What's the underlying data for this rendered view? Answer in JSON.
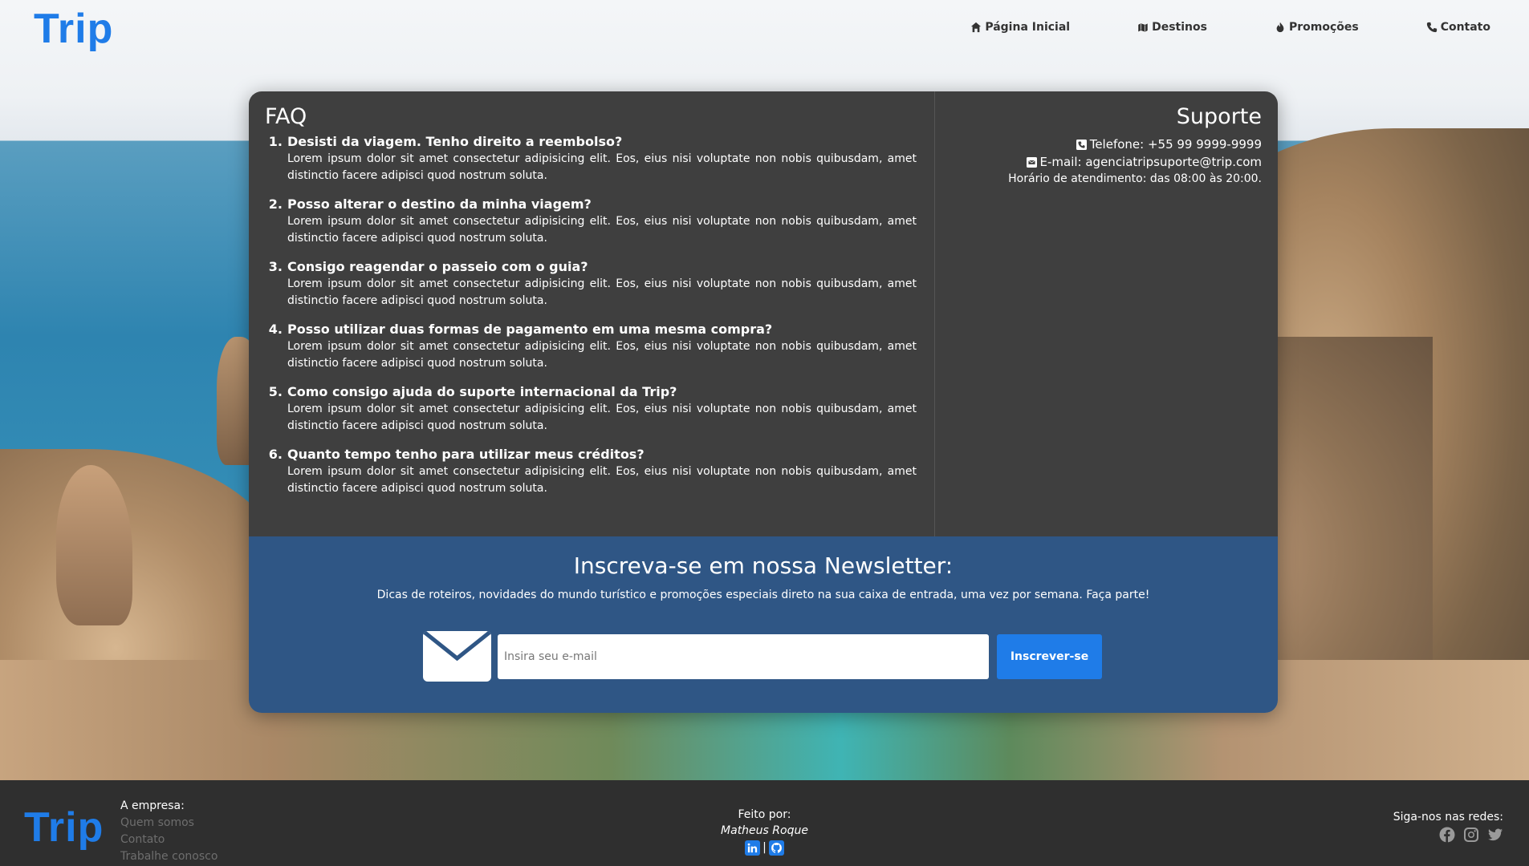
{
  "brand": {
    "logo": "Trip"
  },
  "nav": {
    "items": [
      {
        "label": "Página Inicial",
        "icon": "home-icon"
      },
      {
        "label": "Destinos",
        "icon": "map-icon"
      },
      {
        "label": "Promoções",
        "icon": "fire-icon"
      },
      {
        "label": "Contato",
        "icon": "phone-icon"
      }
    ]
  },
  "faq": {
    "title": "FAQ",
    "items": [
      {
        "num": "1.",
        "question": "Desisti da viagem. Tenho direito a reembolso?",
        "answer": "Lorem ipsum dolor sit amet consectetur adipisicing elit. Eos, eius nisi voluptate non nobis quibusdam, amet distinctio facere adipisci quod nostrum soluta."
      },
      {
        "num": "2.",
        "question": "Posso alterar o destino da minha viagem?",
        "answer": "Lorem ipsum dolor sit amet consectetur adipisicing elit. Eos, eius nisi voluptate non nobis quibusdam, amet distinctio facere adipisci quod nostrum soluta."
      },
      {
        "num": "3.",
        "question": "Consigo reagendar o passeio com o guia?",
        "answer": "Lorem ipsum dolor sit amet consectetur adipisicing elit. Eos, eius nisi voluptate non nobis quibusdam, amet distinctio facere adipisci quod nostrum soluta."
      },
      {
        "num": "4.",
        "question": "Posso utilizar duas formas de pagamento em uma mesma compra?",
        "answer": "Lorem ipsum dolor sit amet consectetur adipisicing elit. Eos, eius nisi voluptate non nobis quibusdam, amet distinctio facere adipisci quod nostrum soluta."
      },
      {
        "num": "5.",
        "question": "Como consigo ajuda do suporte internacional da Trip?",
        "answer": "Lorem ipsum dolor sit amet consectetur adipisicing elit. Eos, eius nisi voluptate non nobis quibusdam, amet distinctio facere adipisci quod nostrum soluta."
      },
      {
        "num": "6.",
        "question": "Quanto tempo tenho para utilizar meus créditos?",
        "answer": "Lorem ipsum dolor sit amet consectetur adipisicing elit. Eos, eius nisi voluptate non nobis quibusdam, amet distinctio facere adipisci quod nostrum soluta."
      }
    ]
  },
  "support": {
    "title": "Suporte",
    "phone": "Telefone: +55 99 9999-9999",
    "email": "E-mail: agenciatripsuporte@trip.com",
    "hours": "Horário de atendimento: das 08:00 às 20:00."
  },
  "newsletter": {
    "title": "Inscreva-se em nossa Newsletter:",
    "subtitle": "Dicas de roteiros, novidades do mundo turístico e promoções especiais direto na sua caixa de entrada, uma vez por semana. Faça parte!",
    "input_placeholder": "Insira seu e-mail",
    "input_value": "",
    "button_label": "Inscrever-se"
  },
  "footer": {
    "company_heading": "A empresa:",
    "company_links": [
      "Quem somos",
      "Contato",
      "Trabalhe conosco"
    ],
    "made_by_label": "Feito por:",
    "made_by_name": "Matheus Roque",
    "separator": "|",
    "social_heading": "Siga-nos nas redes:"
  },
  "colors": {
    "accent": "#1f7ce8",
    "card_dark": "#3f3f3f",
    "newsletter_bg": "#2f5685",
    "footer_bg": "#2f2f2f"
  }
}
